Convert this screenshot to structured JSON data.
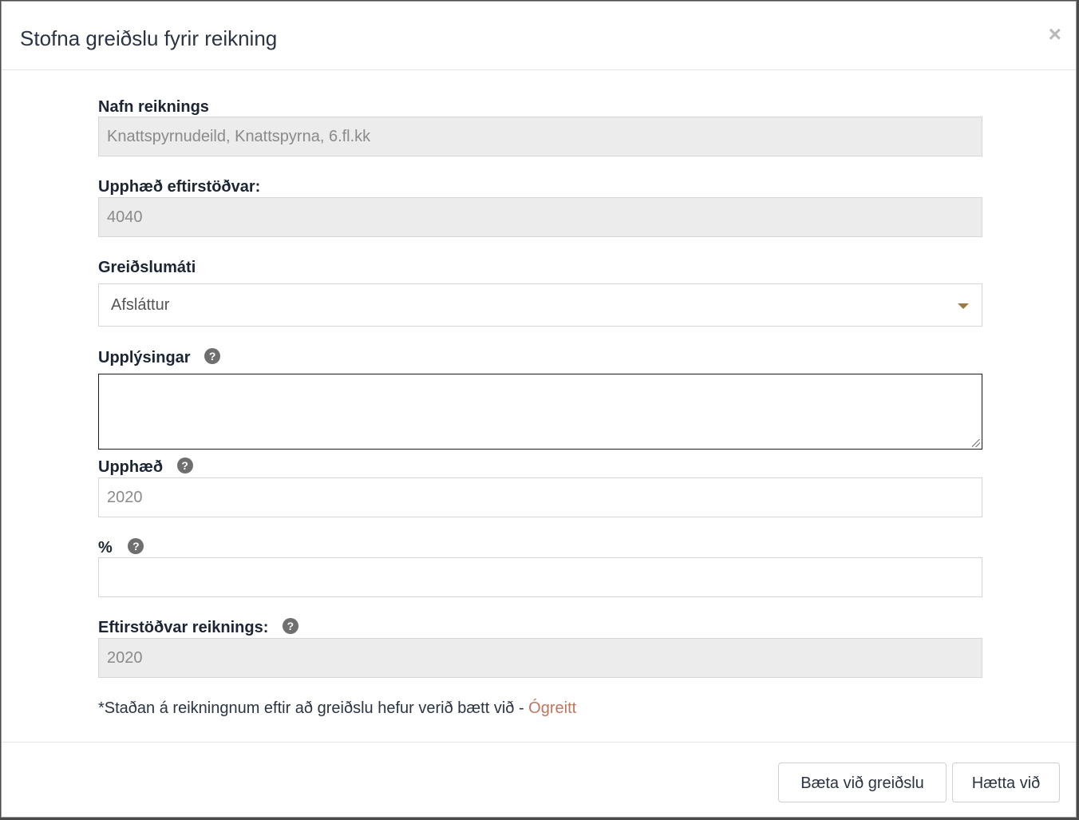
{
  "modal": {
    "title": "Stofna greiðslu fyrir reikning",
    "close_label": "×"
  },
  "form": {
    "account_name": {
      "label": "Nafn reiknings",
      "value": "Knattspyrnudeild, Knattspyrna, 6.fl.kk"
    },
    "balance_amount": {
      "label": "Upphæð eftirstöðvar:",
      "value": "4040"
    },
    "payment_method": {
      "label": "Greiðslumáti",
      "selected": "Afsláttur"
    },
    "information": {
      "label": "Upplýsingar",
      "value": ""
    },
    "amount": {
      "label": "Upphæð",
      "value": "2020"
    },
    "percent": {
      "label": "%",
      "value": ""
    },
    "account_balance": {
      "label": "Eftirstöðvar reiknings:",
      "value": "2020"
    },
    "note": {
      "text": "*Staðan á reikningnum eftir að greiðslu hefur verið bætt við - ",
      "status": "Ógreitt"
    },
    "help_icon_glyph": "?"
  },
  "footer": {
    "add_payment_label": "Bæta við greiðslu",
    "cancel_label": "Hætta við"
  },
  "colors": {
    "status_unpaid": "#c0755d",
    "caret": "#9a7a45"
  }
}
